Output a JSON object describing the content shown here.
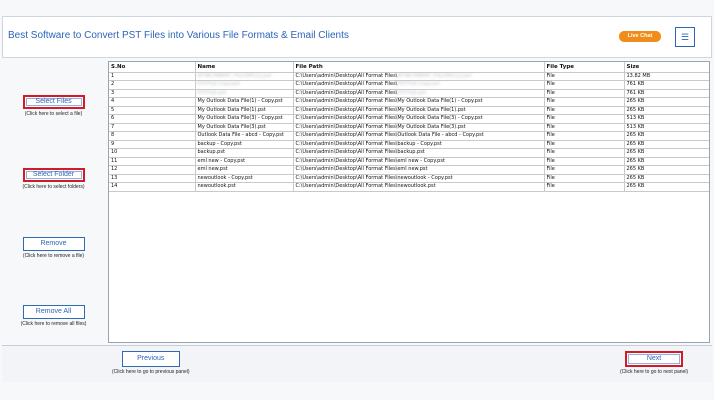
{
  "header": {
    "title": "Best Software to Convert PST Files into Various File Formats & Email Clients",
    "live_chat": "Live Chat",
    "menu_icon": "☰"
  },
  "sidebar": {
    "select_files": "Select Files",
    "select_files_help": "(Click here to select a file)",
    "select_folder": "Select Folder",
    "select_folder_help": "(Click here to select folders)",
    "remove": "Remove",
    "remove_help": "(Click here to remove a file)",
    "remove_all": "Remove All",
    "remove_all_help": "(Click here to remove all files)"
  },
  "table": {
    "columns": [
      "S.No",
      "Name",
      "File Path",
      "File Type",
      "Size"
    ],
    "rows": [
      {
        "sno": "1",
        "name": "ATTACHMENT_FOLDER-[1].pst",
        "path_prefix": "C:\\Users\\admin\\Desktop\\All Format Files\\",
        "path_rest": "ATTACHMENT_FOLDER-[1].pst",
        "blur": true,
        "type": "File",
        "size": "13.82 MB"
      },
      {
        "sno": "2",
        "name": "PSTFILE-Copy.pst",
        "path_prefix": "C:\\Users\\admin\\Desktop\\All Format Files\\",
        "path_rest": "PSTFILE-Copy.pst",
        "blur": true,
        "type": "File",
        "size": "761 KB"
      },
      {
        "sno": "3",
        "name": "PSTFILE.pst",
        "path_prefix": "C:\\Users\\admin\\Desktop\\All Format Files\\",
        "path_rest": "PSTFILE.pst",
        "blur": true,
        "type": "File",
        "size": "761 KB"
      },
      {
        "sno": "4",
        "name": "My Outlook Data File(1) - Copy.pst",
        "path_prefix": "C:\\Users\\admin\\Desktop\\All Format Files\\",
        "path_rest": "My Outlook Data File(1) - Copy.pst",
        "blur": false,
        "type": "File",
        "size": "265 KB"
      },
      {
        "sno": "5",
        "name": "My Outlook Data File(1).pst",
        "path_prefix": "C:\\Users\\admin\\Desktop\\All Format Files\\",
        "path_rest": "My Outlook Data File(1).pst",
        "blur": false,
        "type": "File",
        "size": "265 KB"
      },
      {
        "sno": "6",
        "name": "My Outlook Data File(3) - Copy.pst",
        "path_prefix": "C:\\Users\\admin\\Desktop\\All Format Files\\",
        "path_rest": "My Outlook Data File(3) - Copy.pst",
        "blur": false,
        "type": "File",
        "size": "513 KB"
      },
      {
        "sno": "7",
        "name": "My Outlook Data File(3).pst",
        "path_prefix": "C:\\Users\\admin\\Desktop\\All Format Files\\",
        "path_rest": "My Outlook Data File(3).pst",
        "blur": false,
        "type": "File",
        "size": "513 KB"
      },
      {
        "sno": "8",
        "name": "Outlook Data File - abcd - Copy.pst",
        "path_prefix": "C:\\Users\\admin\\Desktop\\All Format Files\\",
        "path_rest": "Outlook Data File - abcd - Copy.pst",
        "blur": false,
        "type": "File",
        "size": "265 KB"
      },
      {
        "sno": "9",
        "name": "backup - Copy.pst",
        "path_prefix": "C:\\Users\\admin\\Desktop\\All Format Files\\",
        "path_rest": "backup - Copy.pst",
        "blur": false,
        "type": "File",
        "size": "265 KB"
      },
      {
        "sno": "10",
        "name": "backup.pst",
        "path_prefix": "C:\\Users\\admin\\Desktop\\All Format Files\\",
        "path_rest": "backup.pst",
        "blur": false,
        "type": "File",
        "size": "265 KB"
      },
      {
        "sno": "11",
        "name": "eml new - Copy.pst",
        "path_prefix": "C:\\Users\\admin\\Desktop\\All Format Files\\",
        "path_rest": "eml new - Copy.pst",
        "blur": false,
        "type": "File",
        "size": "265 KB"
      },
      {
        "sno": "12",
        "name": "eml new.pst",
        "path_prefix": "C:\\Users\\admin\\Desktop\\All Format Files\\",
        "path_rest": "eml new.pst",
        "blur": false,
        "type": "File",
        "size": "265 KB"
      },
      {
        "sno": "13",
        "name": "newoutlook - Copy.pst",
        "path_prefix": "C:\\Users\\admin\\Desktop\\All Format Files\\",
        "path_rest": "newoutlook - Copy.pst",
        "blur": false,
        "type": "File",
        "size": "265 KB"
      },
      {
        "sno": "14",
        "name": "newoutlook.pst",
        "path_prefix": "C:\\Users\\admin\\Desktop\\All Format Files\\",
        "path_rest": "newoutlook.pst",
        "blur": false,
        "type": "File",
        "size": "265 KB"
      }
    ]
  },
  "footer": {
    "previous": "Previous",
    "previous_help": "(Click here to go to previous panel)",
    "next": "Next",
    "next_help": "(Click here to go to next panel)"
  },
  "colors": {
    "accent": "#2c64b8",
    "highlight": "#d11b2a",
    "live_chat": "#f08c1a"
  }
}
